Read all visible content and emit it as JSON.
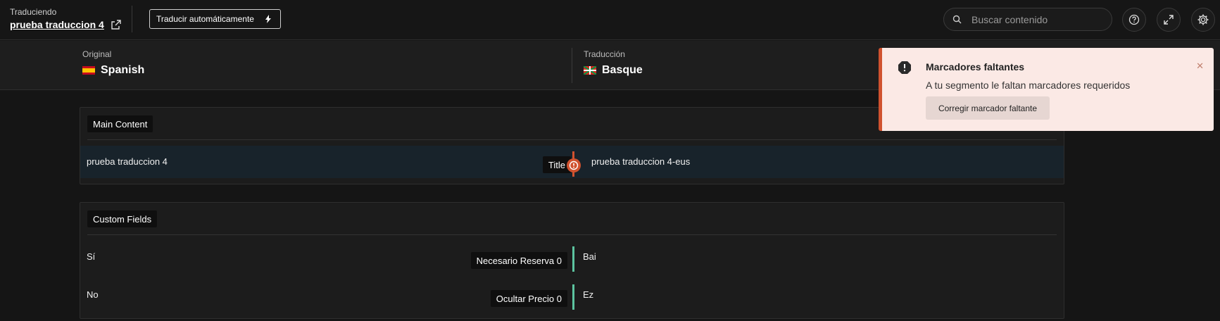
{
  "header": {
    "label": "Traduciendo",
    "title": "prueba traduccion 4",
    "auto_translate": "Traducir automáticamente",
    "search_placeholder": "Buscar contenido"
  },
  "languages": {
    "original_label": "Original",
    "original_name": "Spanish",
    "translation_label": "Traducción",
    "translation_name": "Basque"
  },
  "main_content": {
    "heading": "Main Content",
    "rows": [
      {
        "source": "prueba traduccion 4",
        "field": "Title",
        "target": "prueba traduccion 4-eus"
      }
    ]
  },
  "custom_fields": {
    "heading": "Custom Fields",
    "rows": [
      {
        "source": "Sí",
        "field": "Necesario Reserva 0",
        "target": "Bai"
      },
      {
        "source": "No",
        "field": "Ocultar Precio 0",
        "target": "Ez"
      }
    ]
  },
  "toast": {
    "title": "Marcadores faltantes",
    "message": "A tu segmento le faltan marcadores requeridos",
    "action": "Corregir marcador faltante"
  },
  "colors": {
    "accent_error": "#d0522f",
    "accent_ok": "#5cc4a0"
  }
}
